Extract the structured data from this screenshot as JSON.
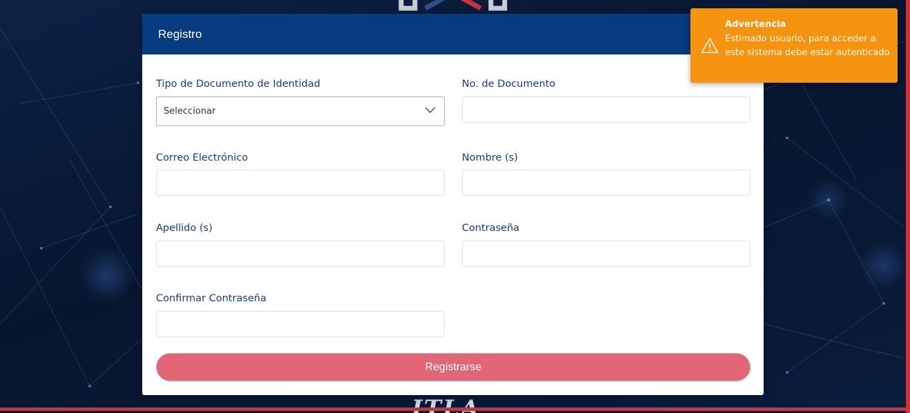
{
  "colors": {
    "header_blue": "#063b7d",
    "label_blue": "#163e73",
    "button_red": "#e26676",
    "toast_orange": "#f7940f",
    "background_navy": "#0b1a33"
  },
  "card": {
    "title": "Registro"
  },
  "form": {
    "doc_type_label": "Tipo de Documento de Identidad",
    "doc_type_selected": "Seleccionar",
    "doc_number_label": "No. de Documento",
    "email_label": "Correo Electrónico",
    "names_label": "Nombre (s)",
    "surnames_label": "Apellido (s)",
    "password_label": "Contraseña",
    "confirm_password_label": "Confirmar Contraseña",
    "submit_label": "Registrarse"
  },
  "toast": {
    "icon": "warning-icon",
    "title": "Advertencia",
    "message": "Estimado usuario, para acceder a este sistema debe estar autenticado"
  },
  "branding": {
    "bottom_logo_text": "ITLA"
  }
}
